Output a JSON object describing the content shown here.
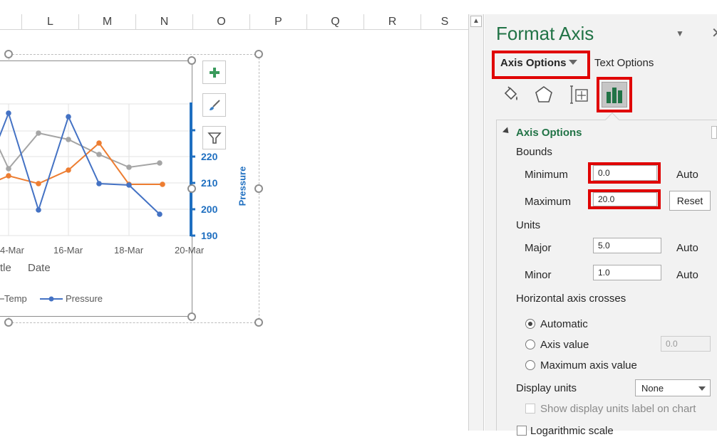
{
  "sheet": {
    "columns": [
      "L",
      "M",
      "N",
      "O",
      "P",
      "Q",
      "R",
      "S"
    ]
  },
  "chart": {
    "x_axis_ticks": [
      "4-Mar",
      "16-Mar",
      "18-Mar",
      "20-Mar"
    ],
    "x_title_partial": "tle",
    "x_title": "Date",
    "right_axis_title": "Pressure",
    "right_axis_ticks": [
      "220",
      "210",
      "200",
      "190"
    ],
    "legend": {
      "temp": "Temp",
      "pressure": "Pressure"
    },
    "colors": {
      "pressure": "#4472c4",
      "temp": "#ed7d31",
      "gray": "#a5a5a5",
      "axis": "#1f6fc0"
    }
  },
  "chart_data": {
    "type": "line",
    "x_axis_ticks": [
      "4-Mar",
      "16-Mar",
      "18-Mar",
      "20-Mar"
    ],
    "x_title": "Date",
    "y2_title": "Pressure",
    "y2_ticks": [
      220,
      210,
      200,
      190
    ],
    "legend_placement": "bottom",
    "grid": true,
    "series": [
      {
        "name": "Pressure",
        "color": "#4472c4"
      },
      {
        "name": "Temp",
        "color": "#ed7d31"
      },
      {
        "color": "#a5a5a5"
      }
    ]
  },
  "pane": {
    "title": "Format Axis",
    "tab_axis_options": "Axis Options",
    "tab_text_options": "Text Options",
    "section_axis_options": "Axis Options",
    "bounds_label": "Bounds",
    "minimum_label": "Minimum",
    "minimum_value": "0.0",
    "minimum_auto": "Auto",
    "maximum_label": "Maximum",
    "maximum_value": "20.0",
    "maximum_reset": "Reset",
    "units_label": "Units",
    "major_label": "Major",
    "major_value": "5.0",
    "major_auto": "Auto",
    "minor_label": "Minor",
    "minor_value": "1.0",
    "minor_auto": "Auto",
    "hcross_label": "Horizontal axis crosses",
    "radio_automatic": "Automatic",
    "radio_axis_value": "Axis value",
    "axis_value_input": "0.0",
    "radio_max_axis_value": "Maximum axis value",
    "display_units_label": "Display units",
    "display_units_value": "None",
    "show_display_units": "Show display units label on chart",
    "log_scale_partial": "Logarithmic scale",
    "accent": "#217346",
    "highlight": "#e00000"
  }
}
